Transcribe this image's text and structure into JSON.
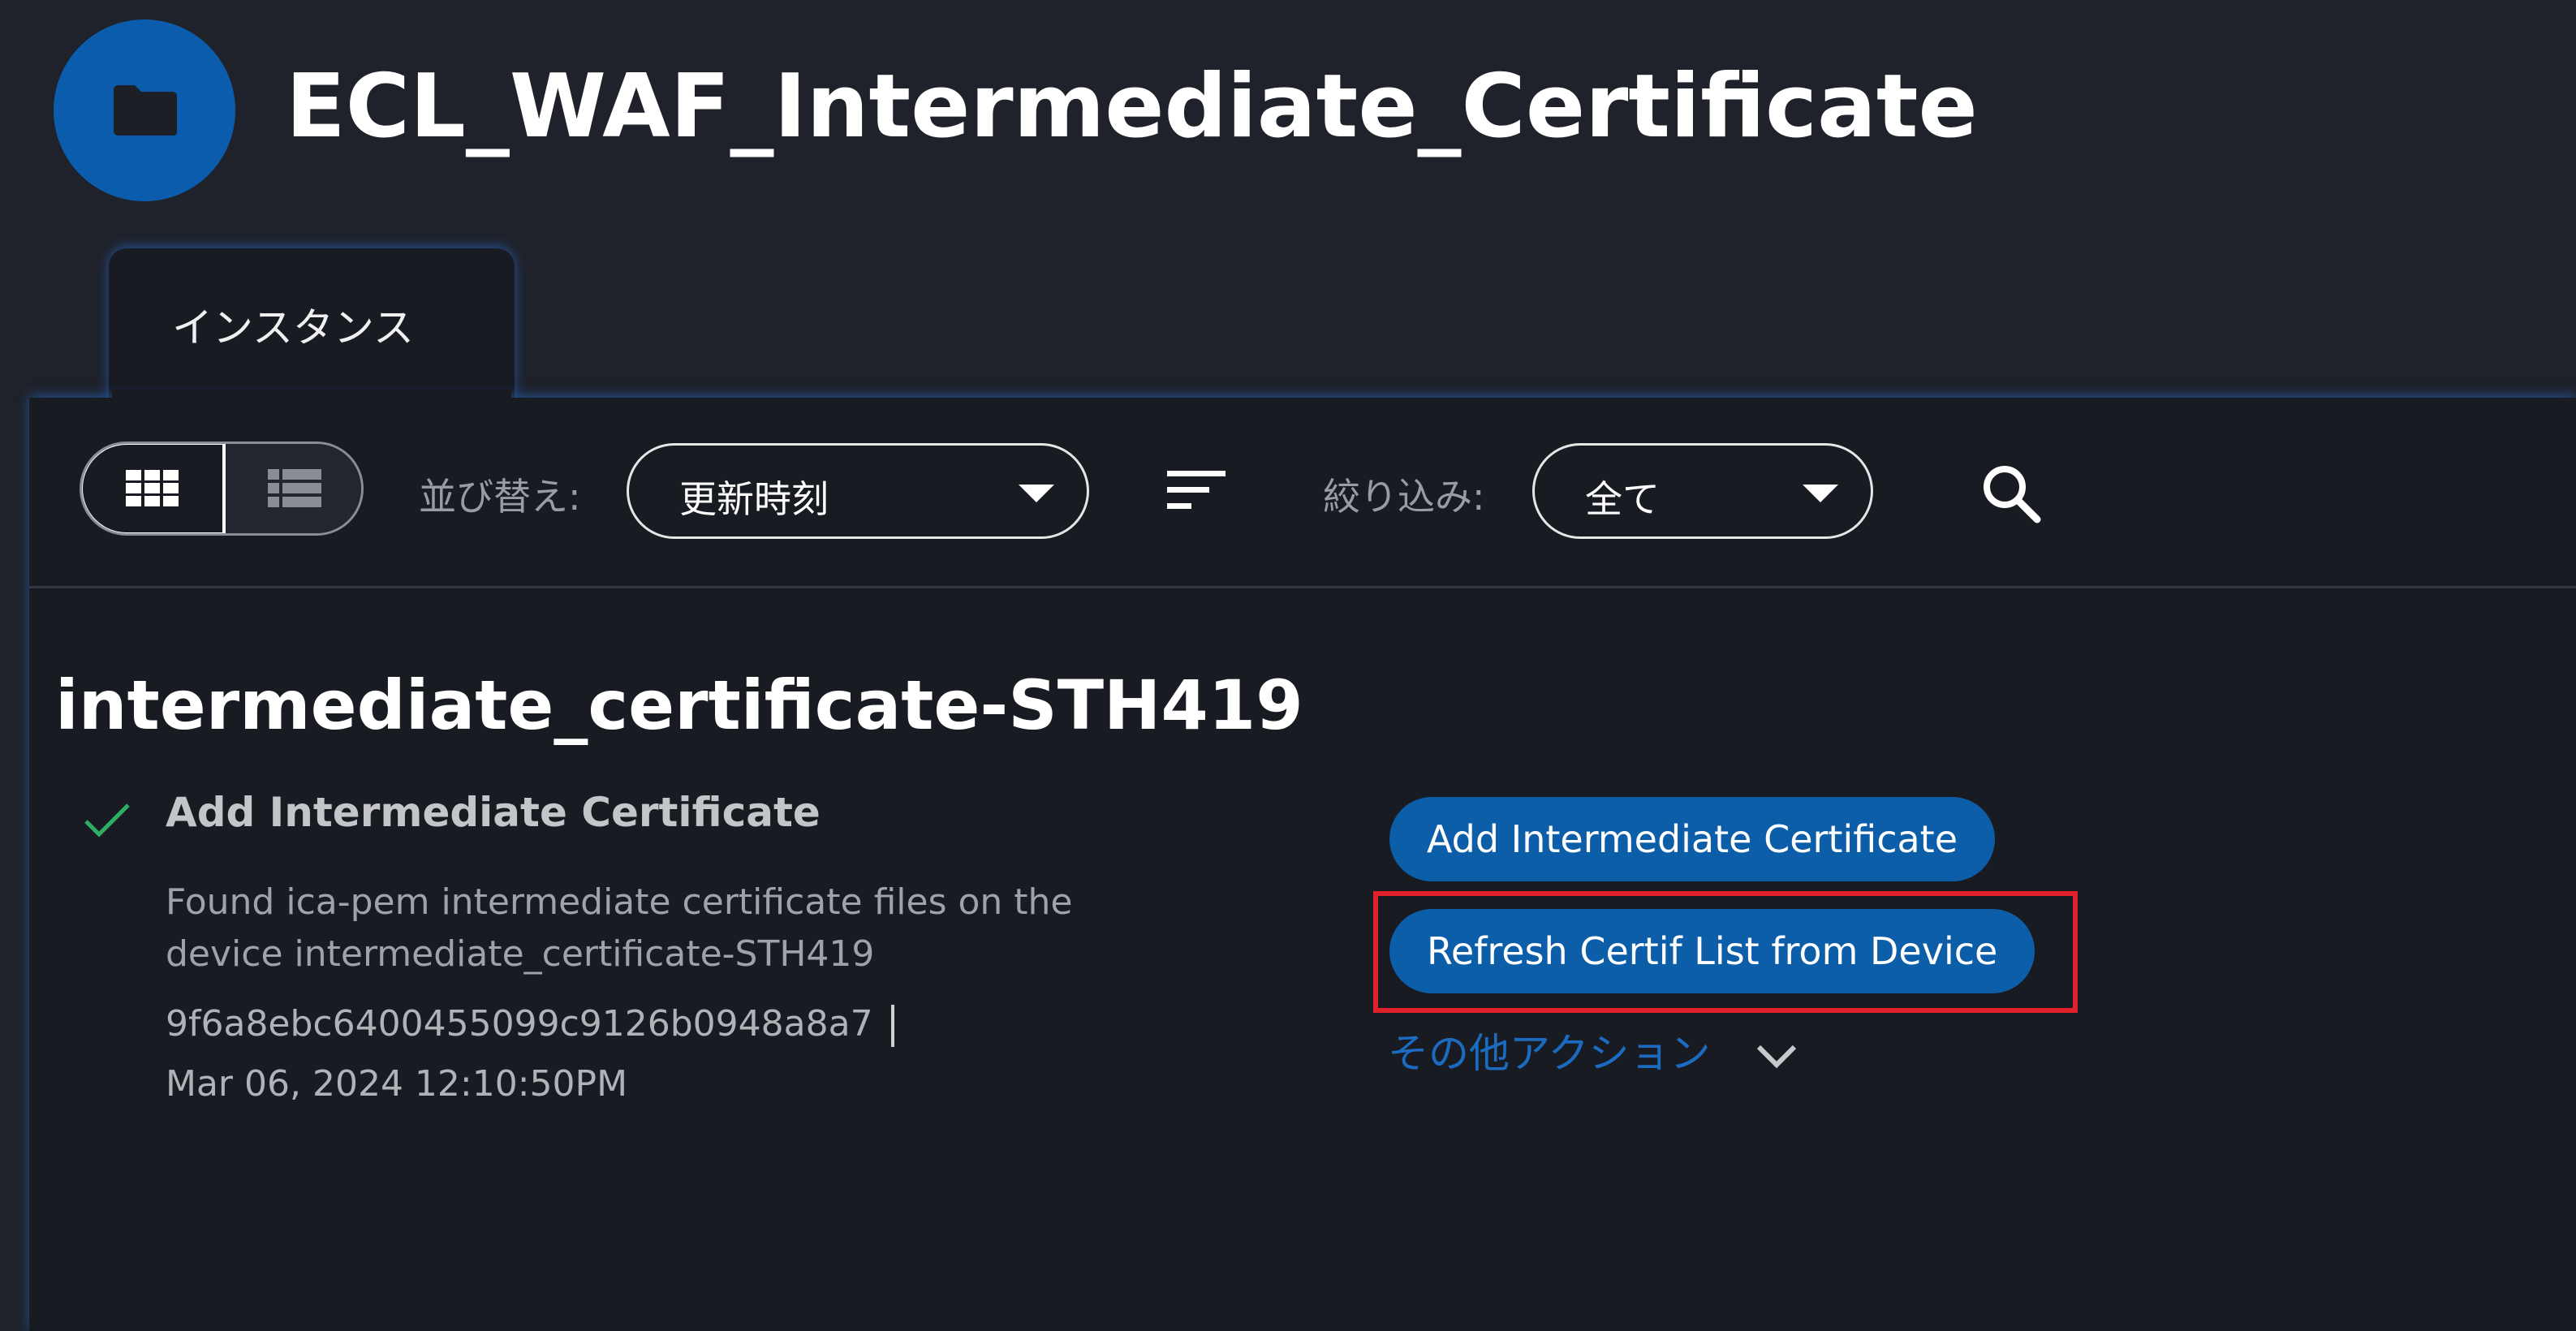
{
  "header": {
    "title": "ECL_WAF_Intermediate_Certificate",
    "icon": "folder-icon"
  },
  "tabs": [
    {
      "label": "インスタンス",
      "active": true
    }
  ],
  "toolbar": {
    "view_grid_icon": "grid-view-icon",
    "view_list_icon": "list-view-icon",
    "sort_label": "並び替え:",
    "sort_value": "更新時刻",
    "filter_label": "絞り込み:",
    "filter_value": "全て",
    "search_icon": "search-icon"
  },
  "instance": {
    "title": "intermediate_certificate-STH419",
    "step_name": "Add Intermediate Certificate",
    "status_icon": "check-icon",
    "description_line1": "Found ica-pem intermediate certificate files on the",
    "description_line2": "device intermediate_certificate-STH419",
    "id": "9f6a8ebc6400455099c9126b0948a8a7",
    "timestamp": "Mar 06, 2024 12:10:50PM",
    "actions": [
      {
        "label": "Add Intermediate Certificate"
      },
      {
        "label": "Refresh Certif List from Device",
        "highlighted": true
      }
    ],
    "more_actions": "その他アクション"
  },
  "colors": {
    "accent": "#0d5ea9",
    "highlight": "#e0202a",
    "success": "#2fae62",
    "background": "#1f222a"
  }
}
